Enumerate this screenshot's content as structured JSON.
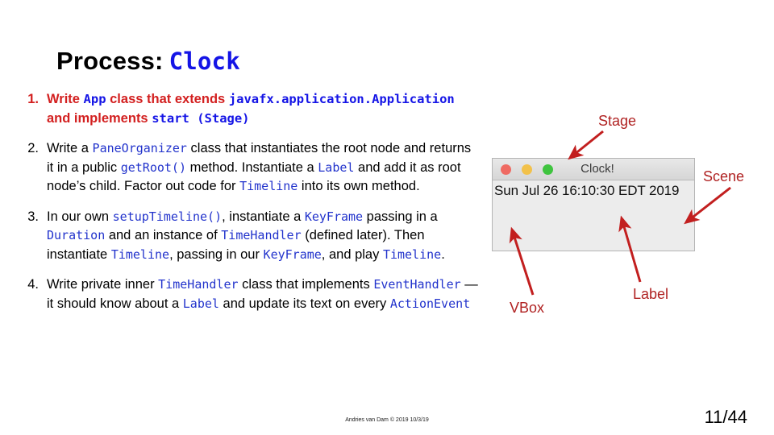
{
  "slide": {
    "title_plain": "Process:",
    "title_code": "Clock",
    "page_number": "11/44",
    "footer_credit": "Andries van Dam © 2019 10/3/19"
  },
  "bullets": [
    {
      "number": "1.",
      "style": "red",
      "segments": [
        {
          "text": "Write ",
          "code": false
        },
        {
          "text": "App",
          "code": true
        },
        {
          "text": " class that extends ",
          "code": false
        },
        {
          "text": "javafx.application.Application",
          "code": true
        },
        {
          "text": " and implements ",
          "code": false
        },
        {
          "text": "start (Stage)",
          "code": true
        }
      ]
    },
    {
      "number": "2.",
      "style": "plain",
      "segments": [
        {
          "text": "Write a ",
          "code": false
        },
        {
          "text": "PaneOrganizer",
          "code": true
        },
        {
          "text": " class that instantiates the root node and returns it in a public ",
          "code": false
        },
        {
          "text": "getRoot()",
          "code": true
        },
        {
          "text": " method. Instantiate a ",
          "code": false
        },
        {
          "text": "Label",
          "code": true
        },
        {
          "text": " and add it as root node’s child. Factor out code for ",
          "code": false
        },
        {
          "text": "Timeline",
          "code": true
        },
        {
          "text": " into its own method.",
          "code": false
        }
      ]
    },
    {
      "number": "3.",
      "style": "plain",
      "segments": [
        {
          "text": "In our own ",
          "code": false
        },
        {
          "text": "setupTimeline()",
          "code": true
        },
        {
          "text": ", instantiate a ",
          "code": false
        },
        {
          "text": "KeyFrame",
          "code": true
        },
        {
          "text": " passing in a ",
          "code": false
        },
        {
          "text": "Duration",
          "code": true
        },
        {
          "text": " and an instance of ",
          "code": false
        },
        {
          "text": "TimeHandler",
          "code": true
        },
        {
          "text": " (defined later). Then instantiate ",
          "code": false
        },
        {
          "text": "Timeline",
          "code": true
        },
        {
          "text": ", passing in our ",
          "code": false
        },
        {
          "text": "KeyFrame",
          "code": true
        },
        {
          "text": ", and play ",
          "code": false
        },
        {
          "text": "Timeline",
          "code": true
        },
        {
          "text": ".",
          "code": false
        }
      ]
    },
    {
      "number": "4.",
      "style": "plain",
      "segments": [
        {
          "text": "Write private inner ",
          "code": false
        },
        {
          "text": "TimeHandler",
          "code": true
        },
        {
          "text": " class that implements ",
          "code": false
        },
        {
          "text": "EventHandler",
          "code": true
        },
        {
          "text": " — it should know about a ",
          "code": false
        },
        {
          "text": "Label",
          "code": true
        },
        {
          "text": " and update its text on every ",
          "code": false
        },
        {
          "text": "ActionEvent",
          "code": true
        }
      ]
    }
  ],
  "clock_window": {
    "title": "Clock!",
    "label_text": "Sun Jul 26 16:10:30 EDT 2019",
    "traffic_lights": {
      "close_color": "#ef6a62",
      "minimize_color": "#f2c14a",
      "maximize_color": "#3fc43f"
    }
  },
  "annotations": [
    {
      "id": "stage",
      "text": "Stage"
    },
    {
      "id": "scene",
      "text": "Scene"
    },
    {
      "id": "vbox",
      "text": "VBox"
    },
    {
      "id": "label",
      "text": "Label"
    }
  ],
  "colors": {
    "annotation_red": "#b02222",
    "bullet_red": "#d32020",
    "code_blue": "#2233cc",
    "title_blue": "#1414e6"
  }
}
